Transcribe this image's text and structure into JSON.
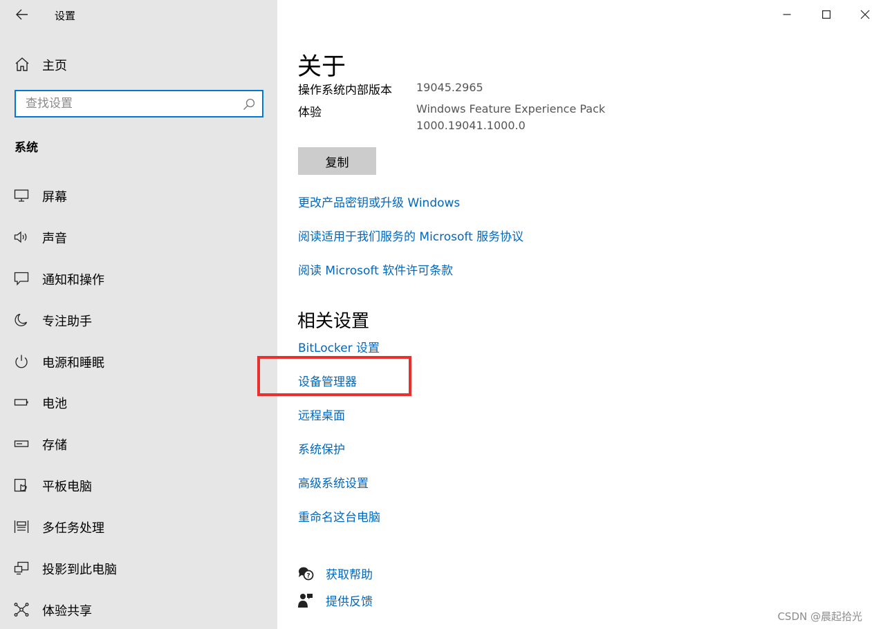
{
  "window": {
    "app_title": "设置",
    "controls": [
      "minimize-icon",
      "maximize-icon",
      "close-icon"
    ]
  },
  "sidebar": {
    "home_label": "主页",
    "search_placeholder": "查找设置",
    "section_label": "系统",
    "items": [
      {
        "label": "屏幕",
        "icon": "monitor-icon"
      },
      {
        "label": "声音",
        "icon": "speaker-icon"
      },
      {
        "label": "通知和操作",
        "icon": "notification-icon"
      },
      {
        "label": "专注助手",
        "icon": "moon-icon"
      },
      {
        "label": "电源和睡眠",
        "icon": "power-icon"
      },
      {
        "label": "电池",
        "icon": "battery-icon"
      },
      {
        "label": "存储",
        "icon": "storage-icon"
      },
      {
        "label": "平板电脑",
        "icon": "tablet-icon"
      },
      {
        "label": "多任务处理",
        "icon": "multitask-icon"
      },
      {
        "label": "投影到此电脑",
        "icon": "project-icon"
      },
      {
        "label": "体验共享",
        "icon": "share-icon"
      }
    ]
  },
  "main": {
    "title": "关于",
    "properties": [
      {
        "label": "操作系统内部版本",
        "value": "19045.2965"
      },
      {
        "label": "体验",
        "value_lines": [
          "Windows Feature Experience Pack",
          "1000.19041.1000.0"
        ]
      }
    ],
    "copy_button": "复制",
    "links": [
      "更改产品密钥或升级 Windows",
      "阅读适用于我们服务的 Microsoft 服务协议",
      "阅读 Microsoft 软件许可条款"
    ],
    "related_title": "相关设置",
    "related_links": [
      "BitLocker 设置",
      "设备管理器",
      "远程桌面",
      "系统保护",
      "高级系统设置",
      "重命名这台电脑"
    ],
    "help": [
      {
        "label": "获取帮助",
        "icon": "help-chat-icon"
      },
      {
        "label": "提供反馈",
        "icon": "feedback-icon"
      }
    ]
  },
  "annotation": {
    "color": "#e8302f"
  },
  "accent_color": "#0078d7",
  "link_color": "#0067c0",
  "watermark": "CSDN @晨起拾光"
}
